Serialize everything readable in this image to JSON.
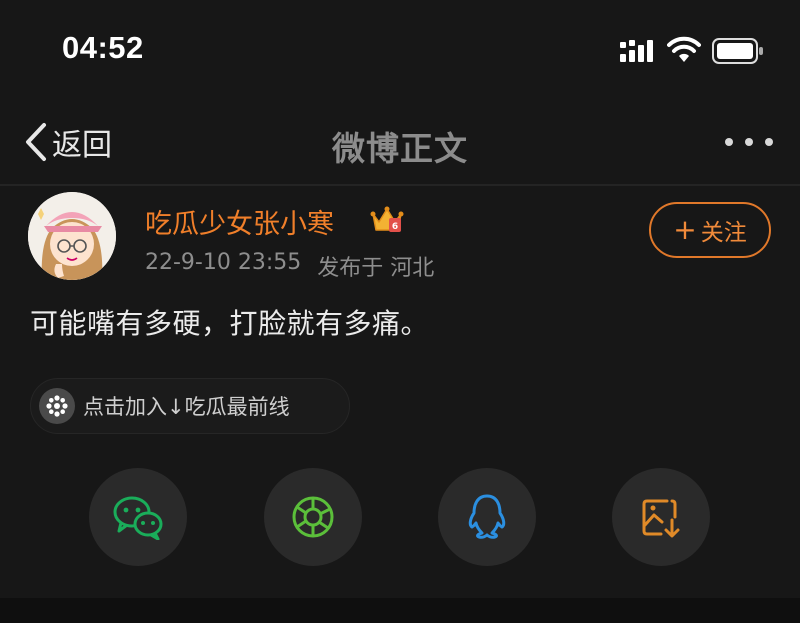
{
  "status_bar": {
    "time": "04:52"
  },
  "nav": {
    "back_label": "返回",
    "title": "微博正文"
  },
  "post": {
    "user_name": "吃瓜少女张小寒",
    "date": "22-9-10 23:55",
    "source": "发布于 河北",
    "follow_label": "关注",
    "text": "可能嘴有多硬，打脸就有多痛。",
    "topic": "点击加入↓吃瓜最前线"
  },
  "share": [
    {
      "icon": "wechat-icon",
      "color": "#1aad5a"
    },
    {
      "icon": "moments-icon",
      "color": "#5bbf3a"
    },
    {
      "icon": "qq-icon",
      "color": "#2b8fe0"
    },
    {
      "icon": "save-image-icon",
      "color": "#e08a28"
    }
  ],
  "colors": {
    "accent": "#f07f2a",
    "background": "#171717"
  }
}
